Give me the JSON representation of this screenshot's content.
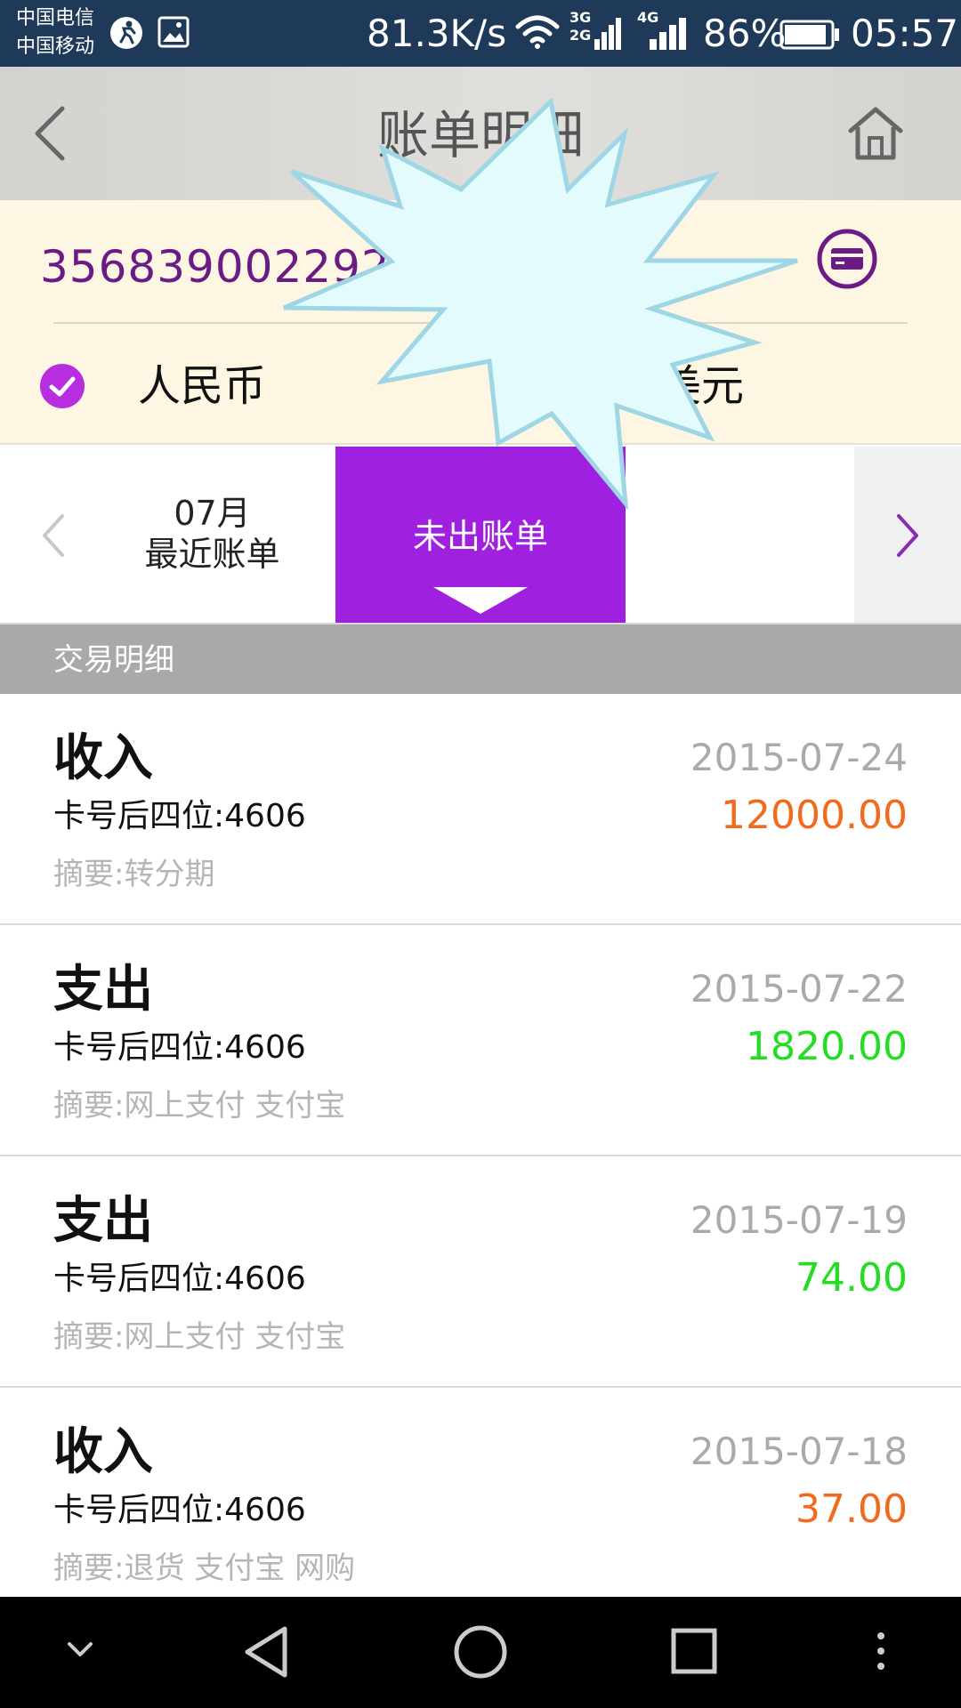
{
  "status_bar": {
    "carrier_1": "中国电信",
    "carrier_2": "中国移动",
    "network_speed": "81.3K/s",
    "signal_label_1": "3G",
    "signal_label_2": "2G",
    "signal_label_3": "4G",
    "battery_percent": "86%",
    "time": "05:57",
    "icons": [
      "running-icon",
      "image-icon",
      "wifi-icon",
      "signal-icon",
      "battery-icon"
    ]
  },
  "header": {
    "title": "账单明细",
    "back_icon": "chevron-left-icon",
    "home_icon": "home-icon"
  },
  "card": {
    "number_visible": "356839002292",
    "switch_icon": "credit-card-icon",
    "currency_selected": "人民币",
    "currency_other_partial": "美元"
  },
  "period_tabs": {
    "recent_month": "07月",
    "recent_label": "最近账单",
    "unbilled_label": "未出账单",
    "active": "未出账单"
  },
  "section_title": "交易明细",
  "transactions": [
    {
      "type": "收入",
      "card_last4": "卡号后四位:4606",
      "date": "2015-07-24",
      "amount": "12000.00",
      "summary": "摘要:转分期",
      "amount_color": "#f26a1b"
    },
    {
      "type": "支出",
      "card_last4": "卡号后四位:4606",
      "date": "2015-07-22",
      "amount": "1820.00",
      "summary": "摘要:网上支付 支付宝",
      "amount_color": "#22dd22"
    },
    {
      "type": "支出",
      "card_last4": "卡号后四位:4606",
      "date": "2015-07-19",
      "amount": "74.00",
      "summary": "摘要:网上支付 支付宝",
      "amount_color": "#22dd22"
    },
    {
      "type": "收入",
      "card_last4": "卡号后四位:4606",
      "date": "2015-07-18",
      "amount": "37.00",
      "summary": "摘要:退货 支付宝 网购",
      "amount_color": "#f26a1b"
    }
  ],
  "colors": {
    "accent_purple": "#a020e0",
    "card_number_purple": "#6a1b84",
    "income_orange": "#f26a1b",
    "expense_green": "#22dd22",
    "starburst_fill": "#e4fbfd",
    "starburst_stroke": "#9ed6e6"
  },
  "nav_bar": {
    "icons": [
      "chevron-down-icon",
      "back-triangle-icon",
      "home-circle-icon",
      "recents-square-icon",
      "more-dots-icon"
    ]
  }
}
